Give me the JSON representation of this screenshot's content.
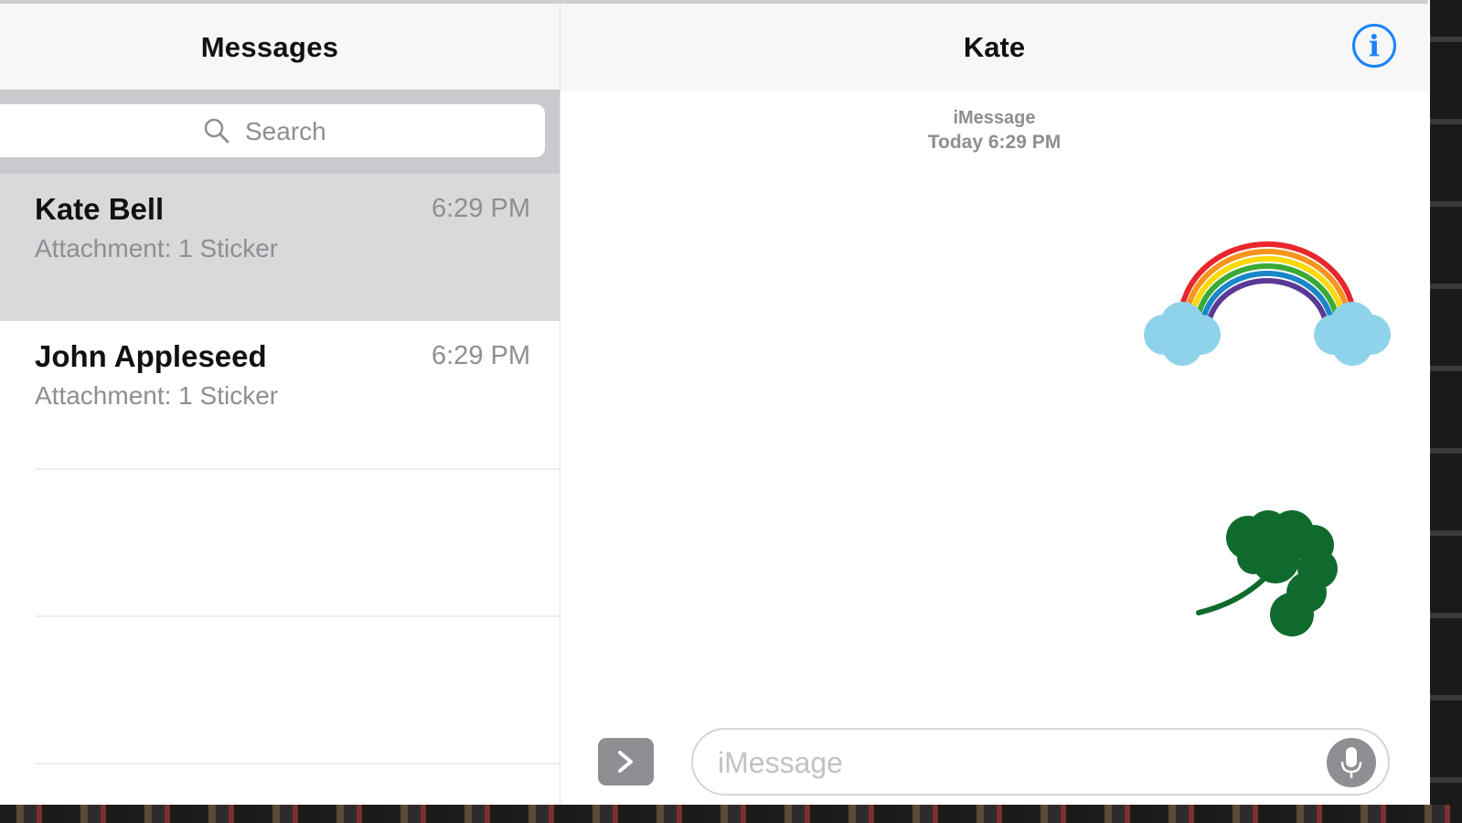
{
  "sidebar": {
    "title": "Messages",
    "search": {
      "placeholder": "Search"
    },
    "conversations": [
      {
        "name": "Kate Bell",
        "time": "6:29 PM",
        "preview": "Attachment: 1 Sticker",
        "selected": true
      },
      {
        "name": "John Appleseed",
        "time": "6:29 PM",
        "preview": "Attachment: 1 Sticker",
        "selected": false
      }
    ]
  },
  "chat": {
    "title": "Kate",
    "info_icon": "info-icon",
    "service_label": "iMessage",
    "timestamp": "Today 6:29 PM",
    "stickers": [
      {
        "name": "rainbow-with-clouds-sticker",
        "colors": [
          "#e8262c",
          "#f7941d",
          "#fdd90b",
          "#3aaa35",
          "#1a86c8",
          "#5b3a96"
        ],
        "cloud_color": "#8fd3ea"
      },
      {
        "name": "shamrock-sticker",
        "color": "#0f6b2d"
      }
    ],
    "composer": {
      "apps_icon": "chevron-right-icon",
      "placeholder": "iMessage",
      "mic_icon": "microphone-icon"
    }
  },
  "colors": {
    "accent": "#1a82ff",
    "selected_row": "#d9d9dc",
    "search_strip": "#c9c9ce",
    "secondary_text": "#8e8e93"
  }
}
